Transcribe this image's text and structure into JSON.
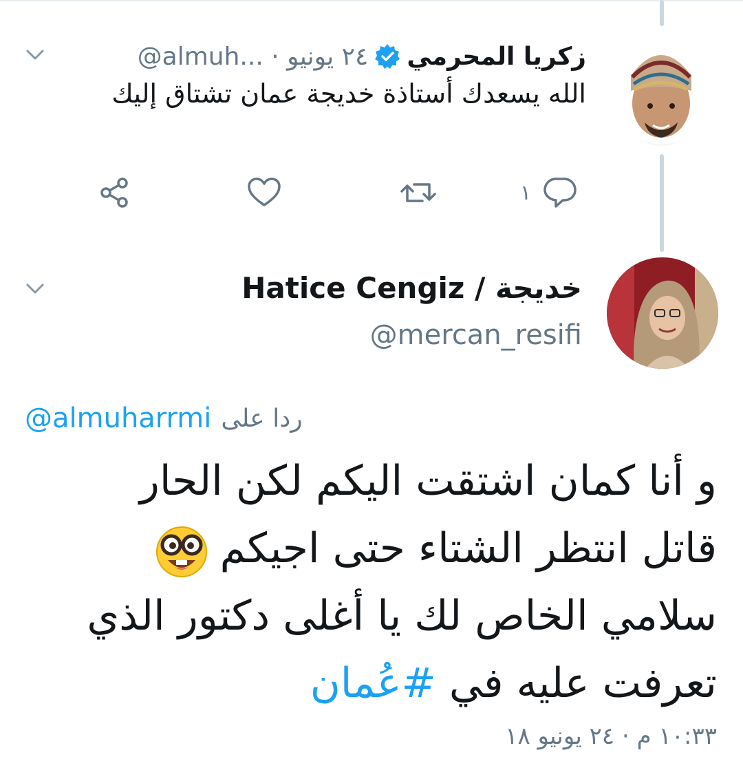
{
  "colors": {
    "link": "#1da1f2",
    "secondary_text": "#657786",
    "primary_text": "#14171a",
    "thread_line": "#ccd6dd"
  },
  "tweet_parent": {
    "display_name": "زكريا المحرمي",
    "verified": true,
    "meta": "@almuh... · ٢٤ يونيو",
    "text": "الله يسعدك أستاذة خديجة عمان تشتاق إليك",
    "avatar_icon": "avatar-man-turban",
    "actions": {
      "reply_icon": "reply-icon",
      "reply_count": "١",
      "retweet_icon": "retweet-icon",
      "like_icon": "heart-icon",
      "share_icon": "share-icon"
    }
  },
  "tweet_main": {
    "display_name": "Hatice Cengiz / خديجة",
    "handle": "@mercan_resifi",
    "avatar_icon": "avatar-woman-hijab",
    "reply_prefix": "ردا على",
    "reply_handle": "@almuharrmi",
    "body_lines": [
      "و أنا كمان اشتقت اليكم لكن الحار",
      "قاتل انتظر الشتاء حتى اجيكم",
      "سلامي الخاص لك يا أغلى دكتور الذي",
      "تعرفت عليه في"
    ],
    "emoji_icon": "nerd-face-emoji",
    "hashtag": "#عُمان",
    "timestamp": "١٠:٣٣ م · ٢٤ يونيو ١٨"
  }
}
